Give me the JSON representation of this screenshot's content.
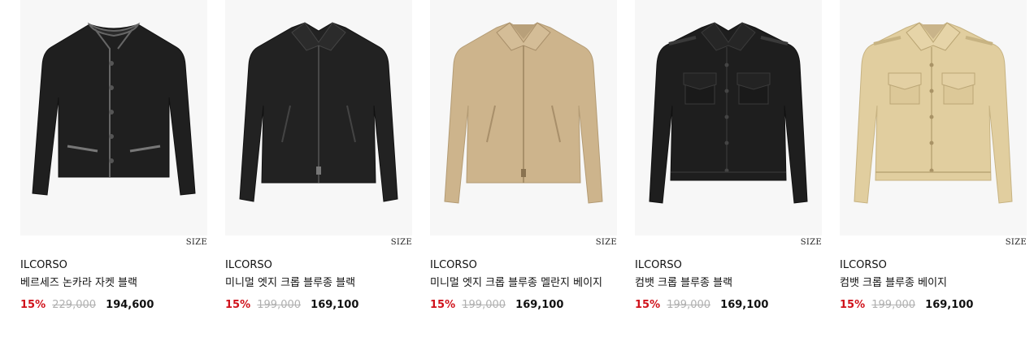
{
  "colors": {
    "discount": "#d0121b",
    "original_price": "#b0b0b0",
    "image_background": "#f7f7f7"
  },
  "products": [
    {
      "image_icon": "black-collarless-jacket-image",
      "size_label": "SIZE",
      "brand": "ILCORSO",
      "name": "베르세즈 논카라 자켓 블랙",
      "discount": "15%",
      "original_price": "229,000",
      "sale_price": "194,600"
    },
    {
      "image_icon": "black-zip-blouson-image",
      "size_label": "SIZE",
      "brand": "ILCORSO",
      "name": "미니멀 엣지 크롭 블루종 블랙",
      "discount": "15%",
      "original_price": "199,000",
      "sale_price": "169,100"
    },
    {
      "image_icon": "beige-linen-zip-blouson-image",
      "size_label": "SIZE",
      "brand": "ILCORSO",
      "name": "미니멀 엣지 크롭 블루종 멜란지 베이지",
      "discount": "15%",
      "original_price": "199,000",
      "sale_price": "169,100"
    },
    {
      "image_icon": "black-combat-blouson-image",
      "size_label": "SIZE",
      "brand": "ILCORSO",
      "name": "컴뱃 크롭 블루종 블랙",
      "discount": "15%",
      "original_price": "199,000",
      "sale_price": "169,100"
    },
    {
      "image_icon": "beige-combat-blouson-image",
      "size_label": "SIZE",
      "brand": "ILCORSO",
      "name": "컴뱃 크롭 블루종 베이지",
      "discount": "15%",
      "original_price": "199,000",
      "sale_price": "169,100"
    }
  ]
}
